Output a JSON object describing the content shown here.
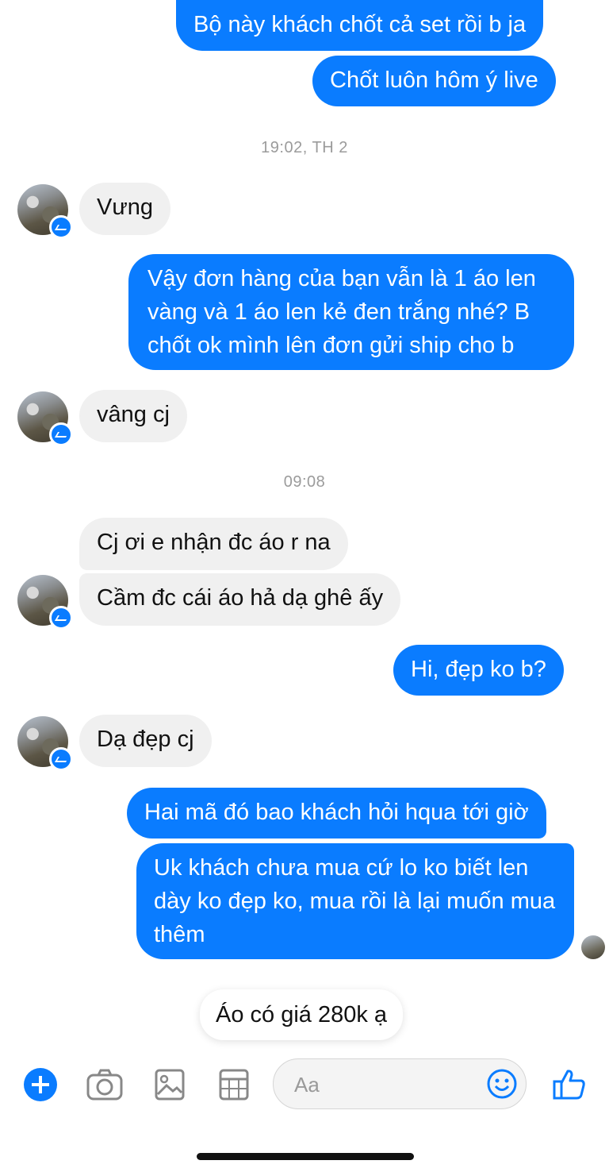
{
  "messages": [
    {
      "text": "Bộ này khách chốt cả set rồi b ja"
    },
    {
      "text": "Chốt luôn hôm ý live"
    },
    {
      "text": "Vưng"
    },
    {
      "text": "Vậy đơn hàng của bạn vẫn là 1 áo len vàng và 1 áo len kẻ đen trắng nhé? B chốt ok mình lên đơn gửi ship cho b"
    },
    {
      "text": "vâng cj"
    },
    {
      "text": "Cj ơi e nhận đc áo r na"
    },
    {
      "text": "Cầm đc cái áo hả dạ ghê ấy"
    },
    {
      "text": "Hi, đẹp ko b?"
    },
    {
      "text": "Dạ đẹp cj"
    },
    {
      "text": "Hai mã đó bao khách hỏi hqua tới giờ"
    },
    {
      "text": "Uk khách chưa mua cứ lo ko biết len dày ko đẹp ko, mua rồi là lại muốn mua thêm"
    }
  ],
  "timestamps": [
    "19:02, TH 2",
    "09:08"
  ],
  "toast": {
    "text": "Áo có giá 280k ạ"
  },
  "composer": {
    "placeholder": "Aa"
  },
  "colors": {
    "accent": "#0a7cff",
    "incoming_bubble": "#f0f0f0",
    "timestamp": "#9b9b9b"
  },
  "icons": [
    "plus-icon",
    "camera-icon",
    "image-icon",
    "sticker-icon",
    "emoji-icon",
    "thumbs-up-icon",
    "messenger-badge-icon"
  ]
}
